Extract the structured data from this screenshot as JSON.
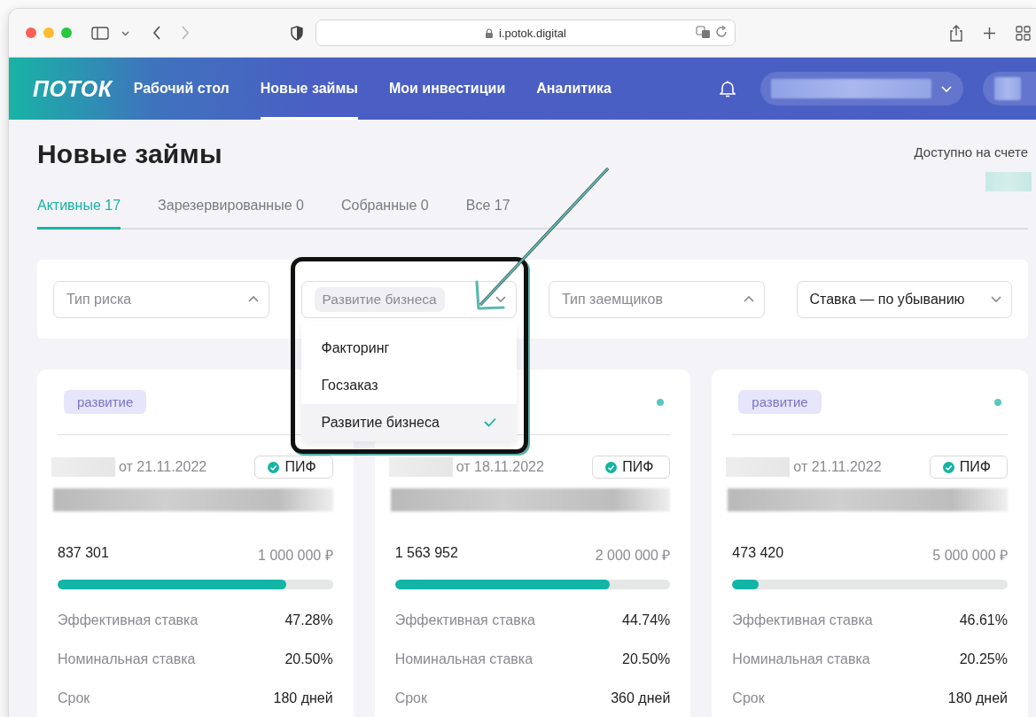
{
  "browser": {
    "url": "i.potok.digital"
  },
  "nav": {
    "logo": "ПОТОК",
    "items": [
      {
        "label": "Рабочий стол",
        "selected": false
      },
      {
        "label": "Новые займы",
        "selected": true
      },
      {
        "label": "Мои инвестиции",
        "selected": false
      },
      {
        "label": "Аналитика",
        "selected": false
      }
    ]
  },
  "page": {
    "title": "Новые займы",
    "balance_label": "Доступно на счете"
  },
  "tabs": [
    {
      "label": "Активные 17",
      "selected": true
    },
    {
      "label": "Зарезервированные 0",
      "selected": false
    },
    {
      "label": "Собранные 0",
      "selected": false
    },
    {
      "label": "Все 17",
      "selected": false
    }
  ],
  "filters": [
    {
      "kind": "select",
      "placeholder": "Тип риска",
      "chevron_up": true
    },
    {
      "kind": "chips",
      "chip": "Развитие бизнеса",
      "chevron_up": false,
      "expanded": true,
      "options": [
        {
          "label": "Факторинг",
          "selected": false
        },
        {
          "label": "Госзаказ",
          "selected": false
        },
        {
          "label": "Развитие бизнеса",
          "selected": true
        }
      ]
    },
    {
      "kind": "select",
      "placeholder": "Тип заемщиков",
      "chevron_up": true
    },
    {
      "kind": "select",
      "value": "Ставка — по убыванию",
      "chevron_up": false
    }
  ],
  "cards": [
    {
      "tag": "развитие",
      "date": "от 21.11.2022",
      "badge": "ПИФ",
      "raised": "837 301",
      "target": "1 000 000 ₽",
      "level": 0.83,
      "rows": [
        {
          "label": "Эффективная ставка",
          "value": "47.28%"
        },
        {
          "label": "Номинальная ставка",
          "value": "20.50%"
        },
        {
          "label": "Срок",
          "value": "180 дней"
        }
      ]
    },
    {
      "status_dot": true,
      "date": "от 18.11.2022",
      "badge": "ПИФ",
      "raised": "1 563 952",
      "target": "2 000 000 ₽",
      "level": 0.78,
      "rows": [
        {
          "label": "Эффективная ставка",
          "value": "44.74%"
        },
        {
          "label": "Номинальная ставка",
          "value": "20.50%"
        },
        {
          "label": "Срок",
          "value": "360 дней"
        }
      ]
    },
    {
      "tag": "развитие",
      "status_dot": true,
      "date": "от 21.11.2022",
      "badge": "ПИФ",
      "raised": "473 420",
      "target": "5 000 000 ₽",
      "level": 0.095,
      "rows": [
        {
          "label": "Эффективная ставка",
          "value": "46.61%"
        },
        {
          "label": "Номинальная ставка",
          "value": "20.25%"
        },
        {
          "label": "Срок",
          "value": "180 дней"
        }
      ]
    }
  ],
  "annotation": {
    "frame": true,
    "arrow": true
  }
}
